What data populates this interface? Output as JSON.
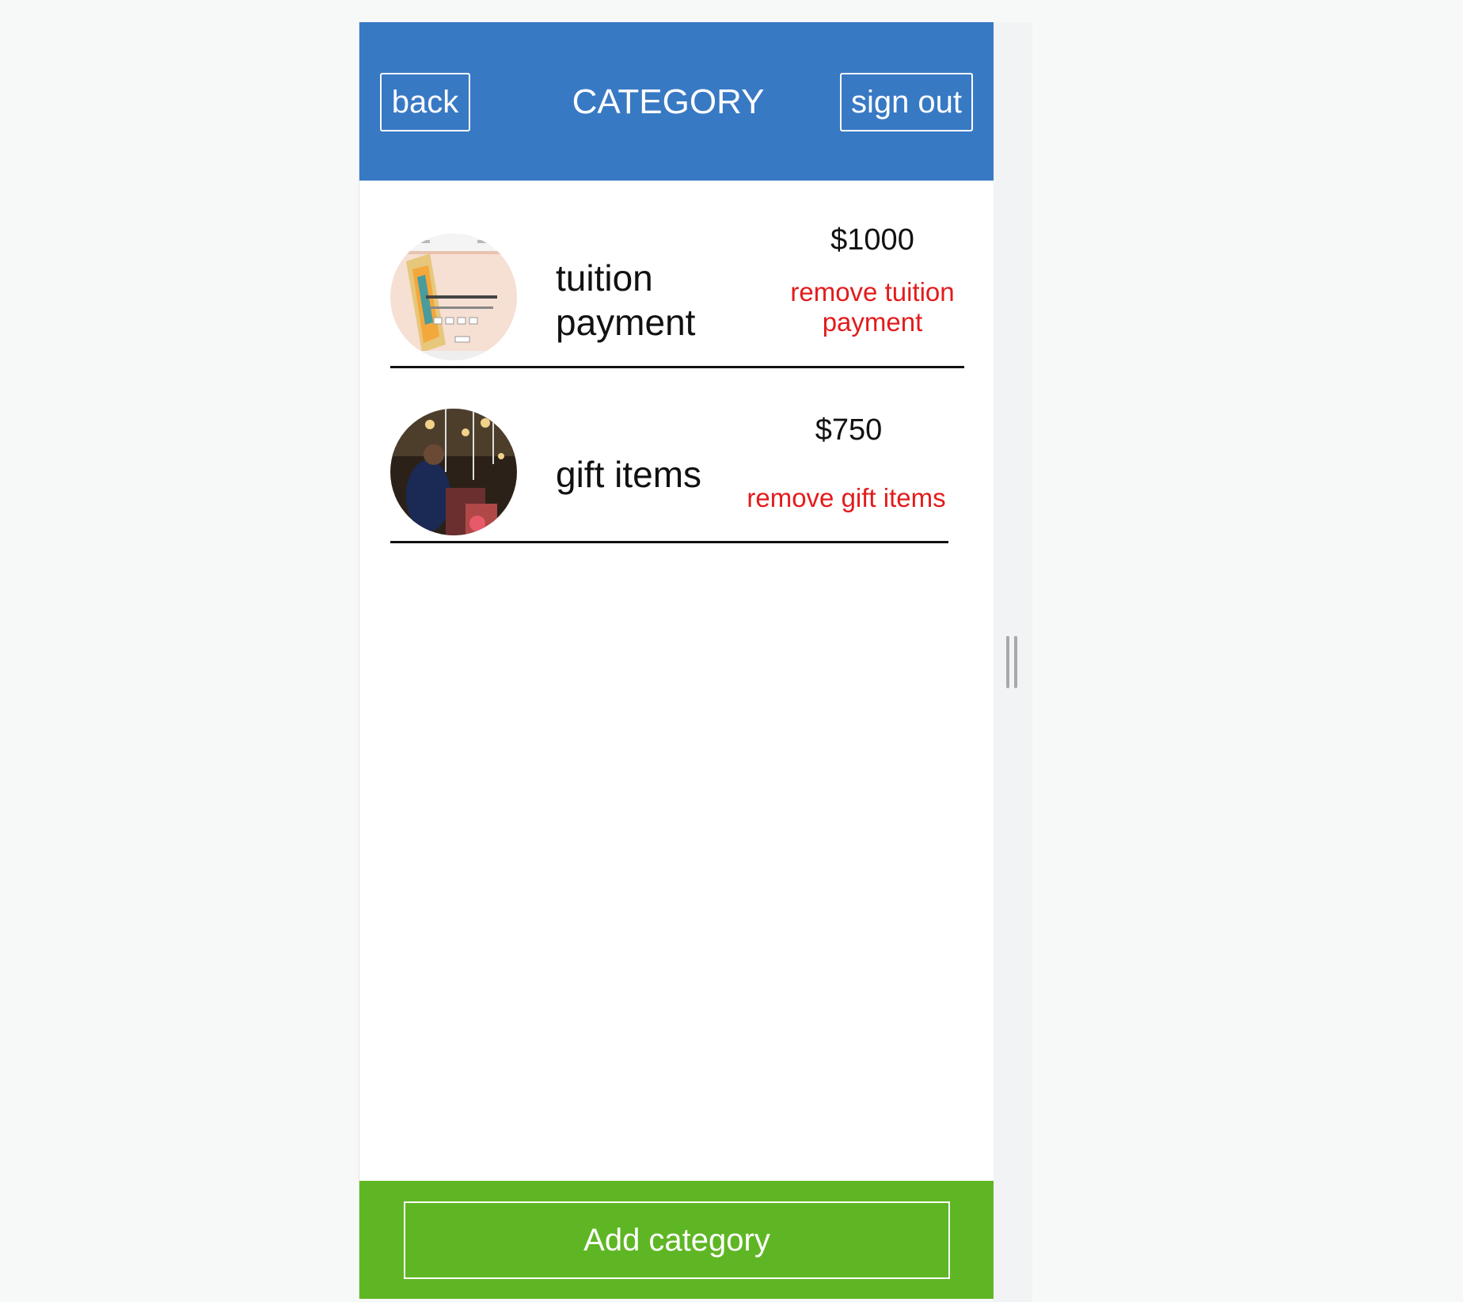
{
  "header": {
    "title": "CATEGORY",
    "back_label": "back",
    "signout_label": "sign out"
  },
  "categories": [
    {
      "name_line1": "tuition",
      "name_line2": "payment",
      "price": "$1000",
      "remove_line1": "remove tuition",
      "remove_line2": "payment",
      "thumbnail": "screenshot-thumbnail"
    },
    {
      "name_line1": "gift items",
      "price": "$750",
      "remove_line1": "remove gift items",
      "thumbnail": "photo-thumbnail"
    }
  ],
  "footer": {
    "add_label": "Add category"
  },
  "colors": {
    "header": "#3879c4",
    "footer": "#5fb624",
    "remove": "#e31b1b"
  }
}
